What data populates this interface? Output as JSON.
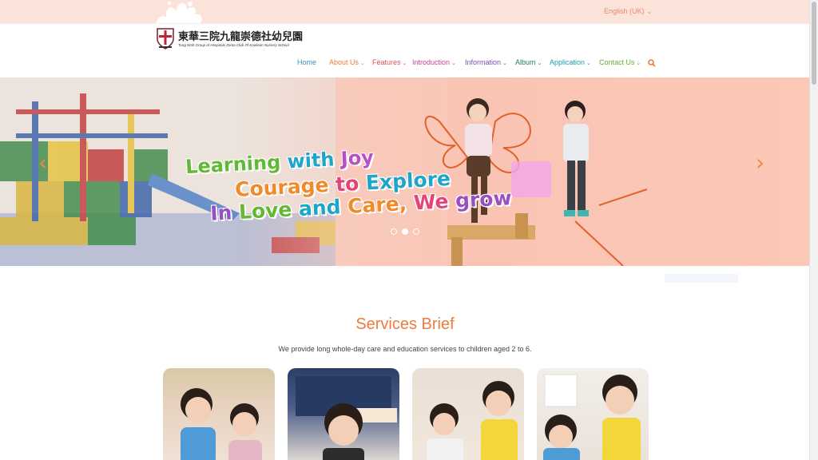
{
  "topbar": {
    "language": "English (UK)"
  },
  "logo": {
    "name_zh": "東華三院九龍崇德社幼兒園",
    "name_en": "Tung Wah Group of Hospitals Zonta Club Of Kowloon Nursery School"
  },
  "nav": {
    "items": [
      {
        "label": "Home",
        "color": "#3f8fc8",
        "dropdown": false
      },
      {
        "label": "About Us",
        "color": "#ee7a3c",
        "dropdown": true
      },
      {
        "label": "Features",
        "color": "#e5504c",
        "dropdown": true
      },
      {
        "label": "Introduction",
        "color": "#c43fa1",
        "dropdown": true
      },
      {
        "label": "Information",
        "color": "#7a4fb8",
        "dropdown": true
      },
      {
        "label": "Album",
        "color": "#1f7a6a",
        "dropdown": true
      },
      {
        "label": "Application",
        "color": "#1b9fb0",
        "dropdown": true
      },
      {
        "label": "Contact Us",
        "color": "#5fae3a",
        "dropdown": true
      }
    ],
    "search_icon": "search-icon",
    "search_color": "#ee7a3c"
  },
  "hero": {
    "tagline": [
      [
        {
          "t": "Learning ",
          "c": "#62b936"
        },
        {
          "t": "with ",
          "c": "#1ca6c9"
        },
        {
          "t": "Joy",
          "c": "#b94fc1"
        }
      ],
      [
        {
          "t": "Courage ",
          "c": "#f08a2b"
        },
        {
          "t": "to ",
          "c": "#e3457a"
        },
        {
          "t": "Explore",
          "c": "#1ca6c9"
        }
      ],
      [
        {
          "t": "In ",
          "c": "#9a4fc1"
        },
        {
          "t": "Love ",
          "c": "#62b936"
        },
        {
          "t": "and ",
          "c": "#1ca6c9"
        },
        {
          "t": "Care, ",
          "c": "#f08a2b"
        },
        {
          "t": "We ",
          "c": "#e3457a"
        },
        {
          "t": "grow",
          "c": "#9a4fc1"
        }
      ]
    ],
    "prev_icon": "chevron-left-icon",
    "next_icon": "chevron-right-icon",
    "slides": 3,
    "active_slide": 2,
    "arrow_color": "#f28a3a"
  },
  "services": {
    "title": "Services Brief",
    "subtitle": "We provide long whole-day care and education services to children aged 2 to 6."
  },
  "colors": {
    "accent": "#ee7a3c",
    "topbar": "#fbe3d9"
  }
}
